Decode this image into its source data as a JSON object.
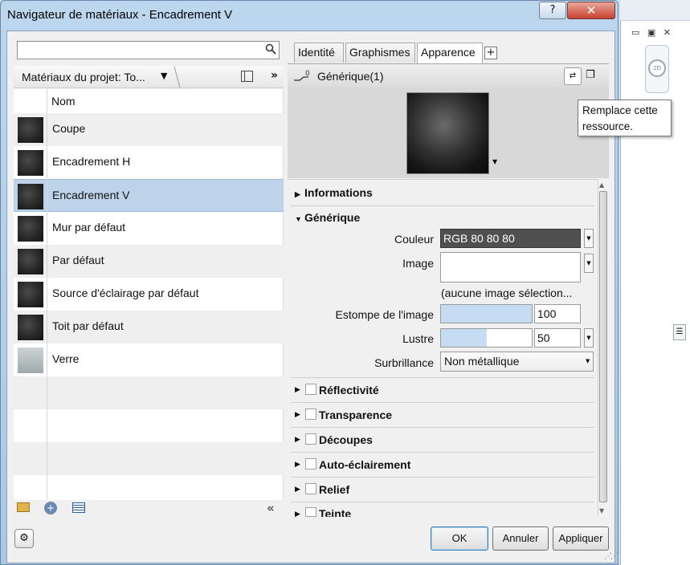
{
  "window": {
    "title": "Navigateur de matériaux - Encadrement V",
    "help_label": "?",
    "close_label": "✕"
  },
  "left_pane": {
    "search_placeholder": "",
    "library_label": "Matériaux du projet: To...",
    "column_header": "Nom",
    "materials": [
      {
        "name": "Coupe",
        "selected": false
      },
      {
        "name": "Encadrement H",
        "selected": false
      },
      {
        "name": "Encadrement V",
        "selected": true
      },
      {
        "name": "Mur par défaut",
        "selected": false
      },
      {
        "name": "Par défaut",
        "selected": false
      },
      {
        "name": "Source d'éclairage par défaut",
        "selected": false
      },
      {
        "name": "Toit par défaut",
        "selected": false
      },
      {
        "name": "Verre",
        "selected": false
      }
    ]
  },
  "tabs": [
    "Identité",
    "Graphismes",
    "Apparence"
  ],
  "active_tab": "Apparence",
  "asset": {
    "name": "Générique(1)"
  },
  "tooltip": {
    "line1": "Remplace cette",
    "line2": "ressource."
  },
  "properties": {
    "informations_label": "Informations",
    "generic_label": "Générique",
    "color_label": "Couleur",
    "color_value": "RGB 80 80 80",
    "color_hex": "#505050",
    "image_label": "Image",
    "no_image_text": "(aucune image sélection...",
    "image_fade_label": "Estompe de l'image",
    "image_fade_value": "100",
    "gloss_label": "Lustre",
    "gloss_value": "50",
    "highlights_label": "Surbrillance",
    "highlights_value": "Non métallique",
    "sections": [
      "Réflectivité",
      "Transparence",
      "Découpes",
      "Auto-éclairement",
      "Relief",
      "Teinte"
    ]
  },
  "buttons": {
    "ok": "OK",
    "cancel": "Annuler",
    "apply": "Appliquer"
  },
  "colors": {
    "selection": "#bcd3ea",
    "title_bar": "#bcd6ee",
    "close_button": "#c8412d"
  }
}
